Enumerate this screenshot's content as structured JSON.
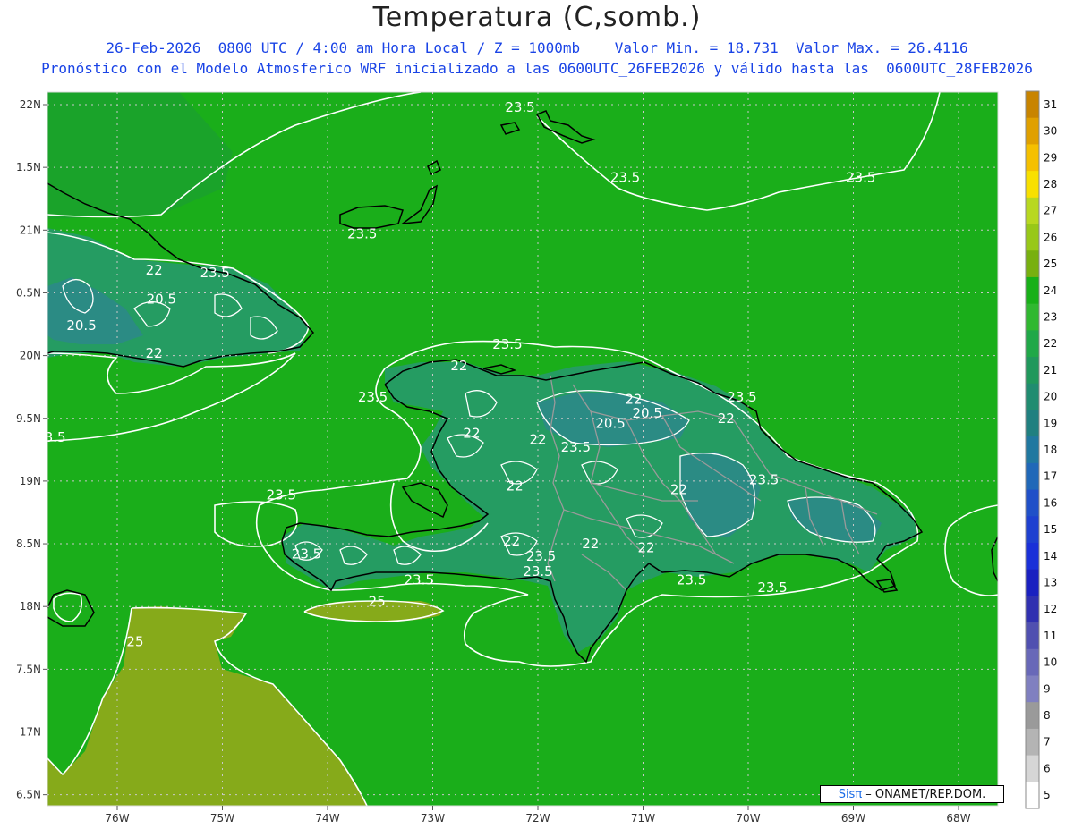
{
  "header": {
    "title": "Temperatura (C,somb.)",
    "subtitle_line1": "26-Feb-2026  0800 UTC / 4:00 am Hora Local / Z = 1000mb    Valor Min. = 18.731  Valor Max. = 26.4116",
    "subtitle_line2": "Pronóstico con el Modelo Atmosferico WRF inicializado a las 0600UTC_26FEB2026 y válido hasta las  0600UTC_28FEB2026"
  },
  "axes": {
    "lon_labels": [
      "76W",
      "75W",
      "74W",
      "73W",
      "72W",
      "71W",
      "70W",
      "69W",
      "68W"
    ],
    "lat_labels": [
      "22N",
      "1.5N",
      "21N",
      "0.5N",
      "20N",
      "9.5N",
      "19N",
      "8.5N",
      "18N",
      "7.5N",
      "17N",
      "6.5N"
    ]
  },
  "contour_labels": [
    {
      "text": "23.5",
      "lon": -72.17,
      "lat": 21.98
    },
    {
      "text": "23.5",
      "lon": -71.17,
      "lat": 21.42
    },
    {
      "text": "23.5",
      "lon": -68.93,
      "lat": 21.42
    },
    {
      "text": "23.5",
      "lon": -73.67,
      "lat": 20.97
    },
    {
      "text": "22",
      "lon": -75.65,
      "lat": 20.68
    },
    {
      "text": "23.5",
      "lon": -75.07,
      "lat": 20.66
    },
    {
      "text": "20.5",
      "lon": -75.58,
      "lat": 20.45
    },
    {
      "text": "20.5",
      "lon": -76.34,
      "lat": 20.24
    },
    {
      "text": "22",
      "lon": -75.65,
      "lat": 20.02
    },
    {
      "text": "23.5",
      "lon": -72.29,
      "lat": 20.09
    },
    {
      "text": "22",
      "lon": -72.75,
      "lat": 19.92
    },
    {
      "text": "23.5",
      "lon": -73.57,
      "lat": 19.67
    },
    {
      "text": "22",
      "lon": -71.09,
      "lat": 19.65
    },
    {
      "text": "23.5",
      "lon": -70.06,
      "lat": 19.67
    },
    {
      "text": "20.5",
      "lon": -70.96,
      "lat": 19.54
    },
    {
      "text": "22",
      "lon": -70.21,
      "lat": 19.5
    },
    {
      "text": "20.5",
      "lon": -71.31,
      "lat": 19.46
    },
    {
      "text": "22",
      "lon": -72.63,
      "lat": 19.38
    },
    {
      "text": "22",
      "lon": -72.0,
      "lat": 19.33
    },
    {
      "text": "23.5",
      "lon": -71.64,
      "lat": 19.27
    },
    {
      "text": "3.5",
      "lon": -76.59,
      "lat": 19.35
    },
    {
      "text": "23.5",
      "lon": -69.85,
      "lat": 19.01
    },
    {
      "text": "22",
      "lon": -72.22,
      "lat": 18.96
    },
    {
      "text": "22",
      "lon": -70.66,
      "lat": 18.93
    },
    {
      "text": "23.5",
      "lon": -74.44,
      "lat": 18.89
    },
    {
      "text": "22",
      "lon": -72.25,
      "lat": 18.52
    },
    {
      "text": "22",
      "lon": -71.5,
      "lat": 18.5
    },
    {
      "text": "23.5",
      "lon": -71.97,
      "lat": 18.4
    },
    {
      "text": "22",
      "lon": -70.97,
      "lat": 18.47
    },
    {
      "text": "23.5",
      "lon": -74.2,
      "lat": 18.42
    },
    {
      "text": "23.5",
      "lon": -72.0,
      "lat": 18.28
    },
    {
      "text": "23.5",
      "lon": -73.13,
      "lat": 18.21
    },
    {
      "text": "23.5",
      "lon": -70.54,
      "lat": 18.21
    },
    {
      "text": "23.5",
      "lon": -69.77,
      "lat": 18.15
    },
    {
      "text": "25",
      "lon": -73.53,
      "lat": 18.04
    },
    {
      "text": "25",
      "lon": -75.83,
      "lat": 17.72
    }
  ],
  "colorbar": {
    "levels": [
      "31",
      "30",
      "29",
      "28",
      "27",
      "26",
      "25",
      "24",
      "23",
      "22",
      "21",
      "20",
      "19",
      "18",
      "17",
      "16",
      "15",
      "14",
      "13",
      "12",
      "11",
      "10",
      "9",
      "8",
      "7",
      "6",
      "5"
    ],
    "colors": [
      "#c88400",
      "#e0a000",
      "#f5c000",
      "#f8e000",
      "#b8d820",
      "#98c818",
      "#78b010",
      "#18b018",
      "#30b830",
      "#20a848",
      "#20985c",
      "#208c70",
      "#208080",
      "#2078a0",
      "#2068b8",
      "#2050c8",
      "#1e40d0",
      "#1a30d8",
      "#1a20c0",
      "#3030b0",
      "#5050b0",
      "#6868b8",
      "#8080c0",
      "#9a9a9a",
      "#b4b4b4",
      "#d6d6d6",
      "#ffffff"
    ]
  },
  "colors": {
    "field_green": "#1aae1a",
    "warm_olive": "#86aa1a",
    "cool_teal": "#269a6a",
    "cold_blue": "#2c8a86",
    "title_blue": "#1a44e6",
    "contour_white": "#ffffff",
    "coast_black": "#000000",
    "border_gray": "#9a9a9a"
  },
  "credit": {
    "brand": "Sisπ",
    "suffix": " – ONAMET/REP.DOM."
  }
}
